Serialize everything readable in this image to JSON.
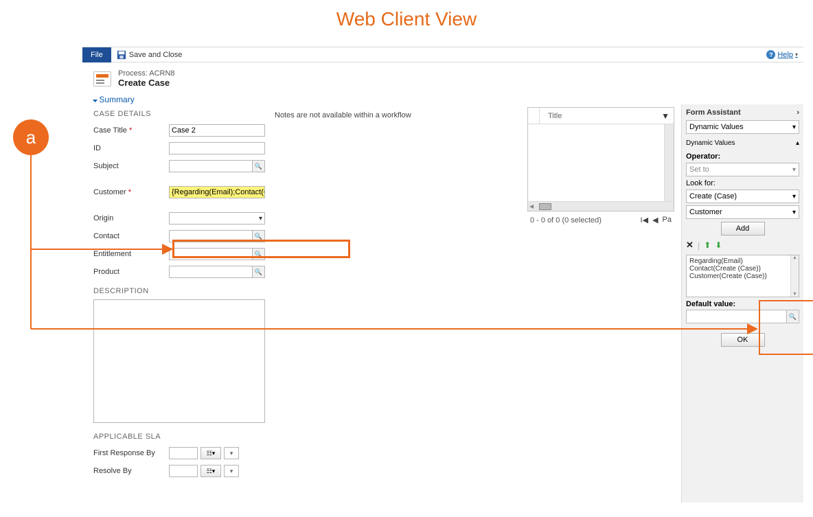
{
  "page": {
    "title": "Web Client View",
    "annotation_letter": "a"
  },
  "ribbon": {
    "file_tab": "File",
    "save_close": "Save and Close",
    "help": "Help"
  },
  "header": {
    "process_label": "Process: ACRN8",
    "step_name": "Create Case",
    "summary_link": "Summary"
  },
  "case_details": {
    "section_title": "CASE DETAILS",
    "fields": {
      "case_title_label": "Case Title",
      "case_title_value": "Case 2",
      "id_label": "ID",
      "id_value": "",
      "subject_label": "Subject",
      "subject_value": "",
      "customer_label": "Customer",
      "customer_value": "{Regarding(Email);Contact(Cr",
      "origin_label": "Origin",
      "origin_value": "",
      "contact_label": "Contact",
      "contact_value": "",
      "entitlement_label": "Entitlement",
      "entitlement_value": "",
      "product_label": "Product",
      "product_value": ""
    }
  },
  "description": {
    "section_title": "DESCRIPTION"
  },
  "sla": {
    "section_title": "APPLICABLE SLA",
    "first_response_label": "First Response By",
    "resolve_label": "Resolve By"
  },
  "notes": {
    "message": "Notes are not available within a workflow"
  },
  "subgrid": {
    "title_column": "Title",
    "footer_count": "0 - 0 of 0 (0 selected)",
    "page_label": "Pa"
  },
  "assistant": {
    "title": "Form Assistant",
    "dynamic_values_dd": "Dynamic Values",
    "dynamic_values_header": "Dynamic Values",
    "operator_label": "Operator:",
    "operator_value": "Set to",
    "look_for_label": "Look for:",
    "look_for_entity": "Create (Case)",
    "look_for_attr": "Customer",
    "add_button": "Add",
    "value_items": [
      "Regarding(Email)",
      "Contact(Create (Case))",
      "Customer(Create (Case))"
    ],
    "default_value_label": "Default value:",
    "ok_button": "OK"
  }
}
